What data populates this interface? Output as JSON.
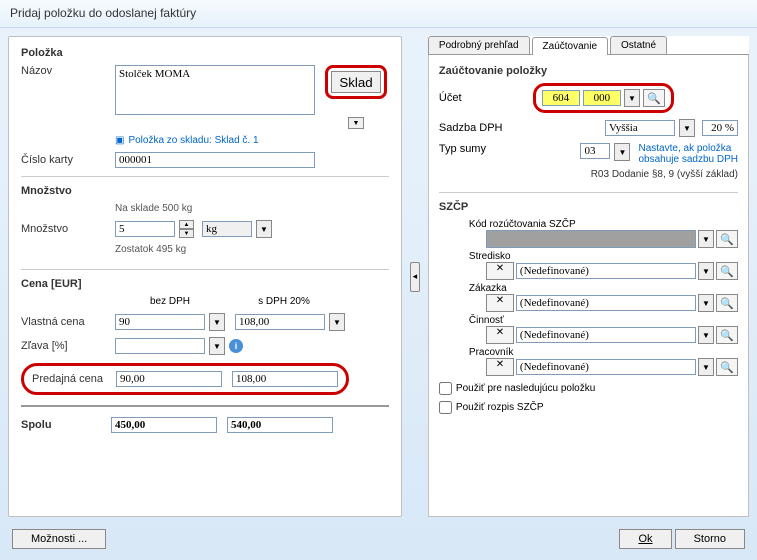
{
  "window": {
    "title": "Pridaj položku do odoslanej faktúry"
  },
  "polozka": {
    "legend": "Položka",
    "nazov_label": "Názov",
    "nazov_value": "Stolček MOMA",
    "sklad_btn": "Sklad",
    "link_text": "Položka zo skladu: Sklad č. 1",
    "cislo_label": "Číslo karty",
    "cislo_value": "000001"
  },
  "mnozstvo": {
    "legend": "Množstvo",
    "na_sklade": "Na sklade  500 kg",
    "label": "Množstvo",
    "value": "5",
    "unit": "kg",
    "zostatok": "Zostatok   495 kg"
  },
  "cena": {
    "legend": "Cena [EUR]",
    "bez_dph": "bez DPH",
    "s_dph": "s DPH 20%",
    "vlastna_label": "Vlastná cena",
    "vlastna_bez": "90",
    "vlastna_s": "108,00",
    "zlava_label": "Zľava [%]",
    "predaj_label": "Predajná cena",
    "predaj_bez": "90,00",
    "predaj_s": "108,00",
    "spolu_label": "Spolu",
    "spolu_bez": "450,00",
    "spolu_s": "540,00"
  },
  "tabs": {
    "t1": "Podrobný prehľad",
    "t2": "Zaúčtovanie",
    "t3": "Ostatné"
  },
  "zauc": {
    "legend": "Zaúčtovanie položky",
    "ucet_label": "Účet",
    "ucet_a": "604",
    "ucet_b": "000",
    "sadzba_label": "Sadzba DPH",
    "sadzba_val": "Vyššia",
    "sadzba_pct": "20 %",
    "typ_label": "Typ sumy",
    "typ_val": "03",
    "typ_note1": "Nastavte, ak položka",
    "typ_note2": "obsahuje sadzbu DPH",
    "typ_note3": "R03 Dodanie §8, 9 (vyšší základ)"
  },
  "szcp": {
    "legend": "SZČP",
    "kod_label": "Kód rozúčtovania SZČP",
    "stredisko": "Stredisko",
    "zakazka": "Zákazka",
    "cinnost": "Činnosť",
    "pracovnik": "Pracovník",
    "nedef": "(Nedefinované)",
    "chk1": "Použiť pre nasledujúcu položku",
    "chk2": "Použiť rozpis SZČP"
  },
  "buttons": {
    "moznosti": "Možnosti ...",
    "ok": "Ok",
    "storno": "Storno"
  }
}
